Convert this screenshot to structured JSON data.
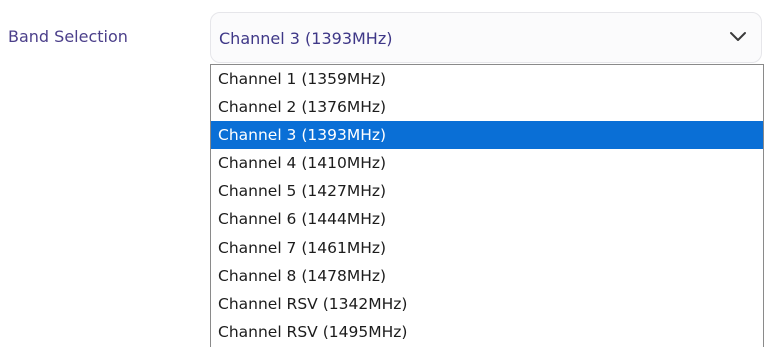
{
  "band_selection": {
    "label": "Band Selection",
    "selected_value": "Channel 3 (1393MHz)",
    "dropdown_icon": "chevron-down-icon",
    "options": [
      "Channel 1 (1359MHz)",
      "Channel 2 (1376MHz)",
      "Channel 3 (1393MHz)",
      "Channel 4 (1410MHz)",
      "Channel 5 (1427MHz)",
      "Channel 6 (1444MHz)",
      "Channel 7 (1461MHz)",
      "Channel 8 (1478MHz)",
      "Channel RSV (1342MHz)",
      "Channel RSV (1495MHz)"
    ],
    "selected_index": 2
  },
  "colors": {
    "label_text": "#4b3f8a",
    "value_text": "#3e3787",
    "highlight": "#0a6fd6"
  }
}
